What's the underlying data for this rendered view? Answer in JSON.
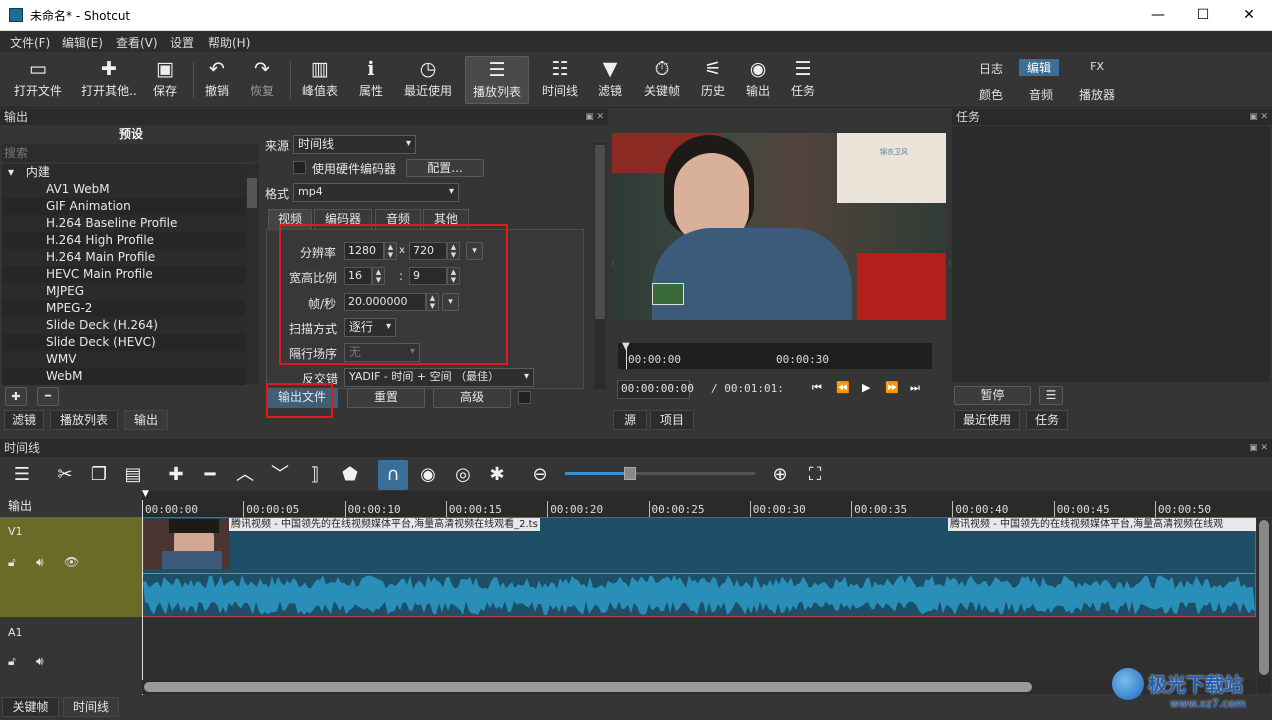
{
  "window": {
    "title": "未命名* - Shotcut",
    "min": "—",
    "max": "☐",
    "close": "✕"
  },
  "menu": [
    "文件(F)",
    "编辑(E)",
    "查看(V)",
    "设置",
    "帮助(H)"
  ],
  "toolbar": {
    "items": [
      {
        "label": "打开文件",
        "icon": "folder-icon",
        "glyph": "▭"
      },
      {
        "label": "打开其他..",
        "icon": "open-other-icon",
        "glyph": "✚"
      },
      {
        "label": "保存",
        "icon": "save-icon",
        "glyph": "▣"
      },
      {
        "label": "撤销",
        "icon": "undo-icon",
        "glyph": "↶"
      },
      {
        "label": "恢复",
        "icon": "redo-icon",
        "glyph": "↷"
      },
      {
        "label": "峰值表",
        "icon": "peak-meter-icon",
        "glyph": "▥"
      },
      {
        "label": "属性",
        "icon": "properties-icon",
        "glyph": "ℹ"
      },
      {
        "label": "最近使用",
        "icon": "recent-icon",
        "glyph": "◷"
      },
      {
        "label": "播放列表",
        "icon": "playlist-icon",
        "glyph": "☰"
      },
      {
        "label": "时间线",
        "icon": "timeline-icon",
        "glyph": "☷"
      },
      {
        "label": "滤镜",
        "icon": "filter-icon",
        "glyph": "▼"
      },
      {
        "label": "关键帧",
        "icon": "keyframe-icon",
        "glyph": "⏱"
      },
      {
        "label": "历史",
        "icon": "history-icon",
        "glyph": "⚟"
      },
      {
        "label": "输出",
        "icon": "export-icon",
        "glyph": "◉"
      },
      {
        "label": "任务",
        "icon": "jobs-icon",
        "glyph": "☰"
      }
    ],
    "layouts_top": [
      "日志",
      "编辑",
      "FX"
    ],
    "layouts_bottom": [
      "颜色",
      "音频",
      "播放器"
    ]
  },
  "export_panel": {
    "title": "输出",
    "presets_title": "预设",
    "search_placeholder": "搜索",
    "group": "内建",
    "presets": [
      "AV1 WebM",
      "GIF Animation",
      "H.264 Baseline Profile",
      "H.264 High Profile",
      "H.264 Main Profile",
      "HEVC Main Profile",
      "MJPEG",
      "MPEG-2",
      "Slide Deck (H.264)",
      "Slide Deck (HEVC)",
      "WMV",
      "WebM"
    ],
    "add": "✚",
    "remove": "━",
    "source_label": "来源",
    "source_value": "时间线",
    "hw_encoder": "使用硬件编码器",
    "configure": "配置...",
    "format_label": "格式",
    "format_value": "mp4",
    "tabs": [
      "视频",
      "编码器",
      "音频",
      "其他"
    ],
    "resolution_label": "分辨率",
    "width": "1280",
    "x_sep": "x",
    "height": "720",
    "aspect_label": "宽高比例",
    "aspect_w": "16",
    "aspect_sep": ":",
    "aspect_h": "9",
    "fps_label": "帧/秒",
    "fps_value": "20.000000",
    "scan_label": "扫描方式",
    "scan_value": "逐行",
    "field_order_label": "隔行场序",
    "field_order_value": "无",
    "deinterlace_label": "反交错",
    "deinterlace_value": "YADIF - 时间 + 空间 （最佳）",
    "export_file": "输出文件",
    "reset": "重置",
    "advanced": "高级"
  },
  "bottom_tabs_left": [
    "滤镜",
    "播放列表",
    "输出"
  ],
  "player": {
    "ruler_start": "00:00:00",
    "ruler_mid": "00:00:30",
    "timecode": "00:00:00:00",
    "duration": "/ 00:01:01:",
    "tabs": [
      "源",
      "项目"
    ],
    "watermark": "锦衣卫风"
  },
  "jobs_panel": {
    "title": "任务",
    "pause": "暂停",
    "menu": "☰",
    "tabs": [
      "最近使用",
      "任务"
    ]
  },
  "timeline": {
    "title": "时间线",
    "output_label": "输出",
    "tracks": [
      "V1",
      "A1"
    ],
    "ruler": [
      "00:00:00",
      "00:00:05",
      "00:00:10",
      "00:00:15",
      "00:00:20",
      "00:00:25",
      "00:00:30",
      "00:00:35",
      "00:00:40",
      "00:00:45",
      "00:00:50"
    ],
    "clip_title": "腾讯视频 - 中国领先的在线视频媒体平台,海量高清视频在线观看_2.ts",
    "clip_title2": "腾讯视频 - 中国领先的在线视频媒体平台,海量高清视频在线观",
    "bottom_tabs": [
      "关键帧",
      "时间线"
    ]
  },
  "watermark_logo": {
    "text": "极光下载站",
    "url": "www.xz7.com"
  }
}
